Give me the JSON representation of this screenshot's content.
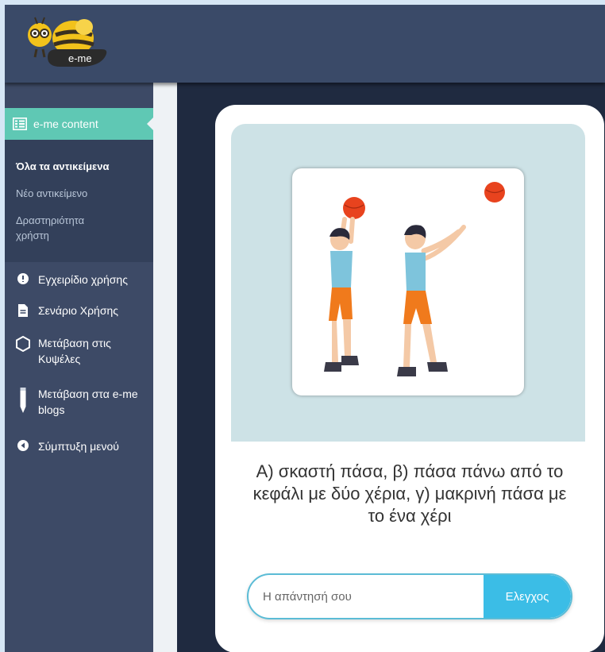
{
  "header": {
    "logo_text": "e-me"
  },
  "sidebar": {
    "active_item": {
      "label": "e-me content",
      "icon": "list-icon"
    },
    "sub_items": [
      "Όλα τα αντικείμενα",
      "Νέο αντικείμενο",
      "Δραστηριότητα χρήστη"
    ],
    "menu_items": [
      {
        "label": "Εγχειρίδιο χρήσης",
        "icon": "info-icon"
      },
      {
        "label": "Σενάριο Χρήσης",
        "icon": "document-icon"
      },
      {
        "label": "Μετάβαση στις Κυψέλες",
        "icon": "hexagon-icon"
      },
      {
        "label": "Μετάβαση στα e-me blogs",
        "icon": "pencil-icon"
      },
      {
        "label": "Σύμπτυξη μενού",
        "icon": "collapse-icon"
      }
    ]
  },
  "quiz": {
    "question": "Α) σκαστή πάσα, β) πάσα πάνω από το κεφάλι με δύο χέρια, γ) μακρινή πάσα με το ένα χέρι",
    "answer_placeholder": "Η απάντησή σου",
    "answer_value": "",
    "check_label": "Ελεγχος"
  },
  "colors": {
    "header_bg": "#3a4a68",
    "sidebar_bg": "#3d4a66",
    "active_item": "#5fc8b4",
    "accent_button": "#3bbde6",
    "image_panel": "#cde2e6"
  }
}
